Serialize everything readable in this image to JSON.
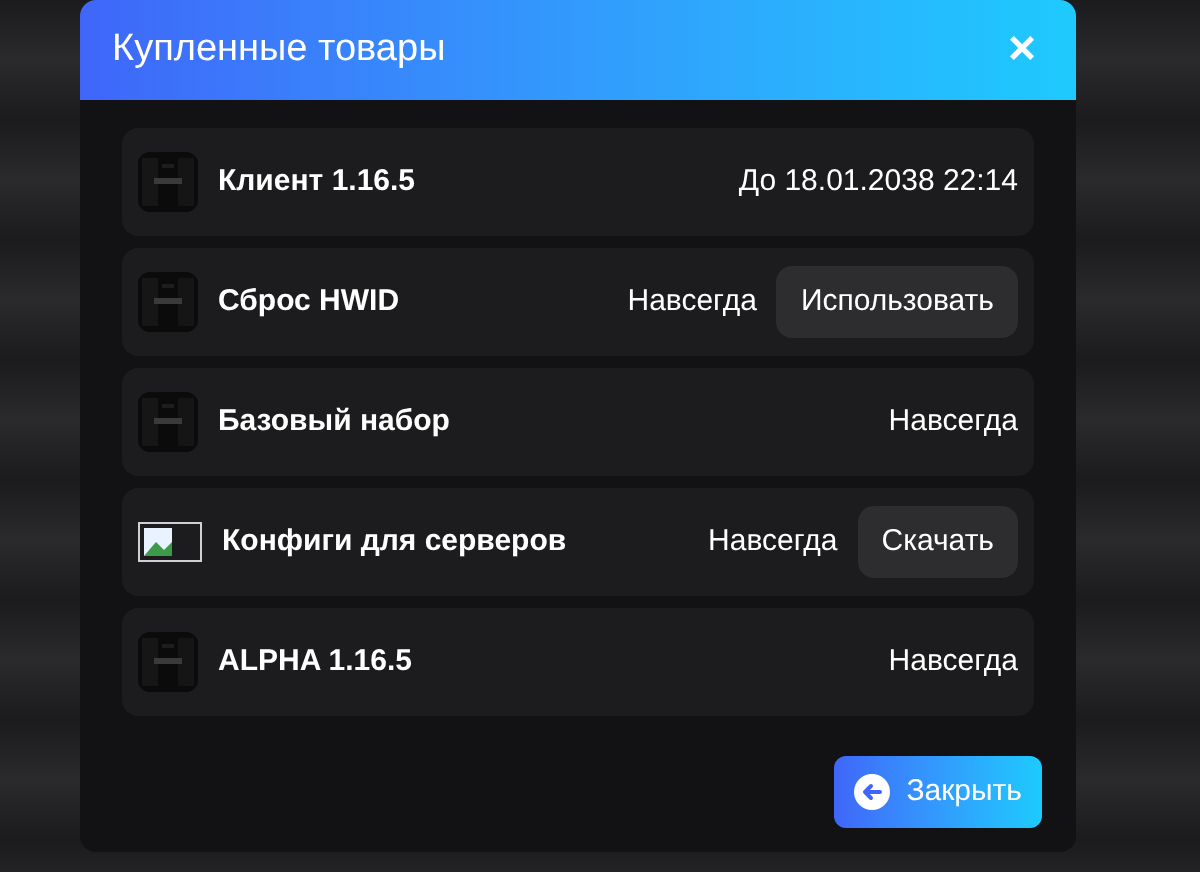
{
  "dialog": {
    "title": "Купленные товары",
    "close_symbol": "×"
  },
  "items": [
    {
      "name": "Клиент 1.16.5",
      "term": "До 18.01.2038 22:14",
      "kind": "picture"
    },
    {
      "name": "Сброс HWID",
      "term": "Навсегда",
      "kind": "picture",
      "action": "Использовать"
    },
    {
      "name": "Базовый набор",
      "term": "Навсегда",
      "kind": "picture"
    },
    {
      "name": "Конфиги для серверов",
      "term": "Навсегда",
      "kind": "broken",
      "action": "Скачать"
    },
    {
      "name": "ALPHA 1.16.5",
      "term": "Навсегда",
      "kind": "picture"
    }
  ],
  "footer": {
    "button": "Закрыть"
  }
}
